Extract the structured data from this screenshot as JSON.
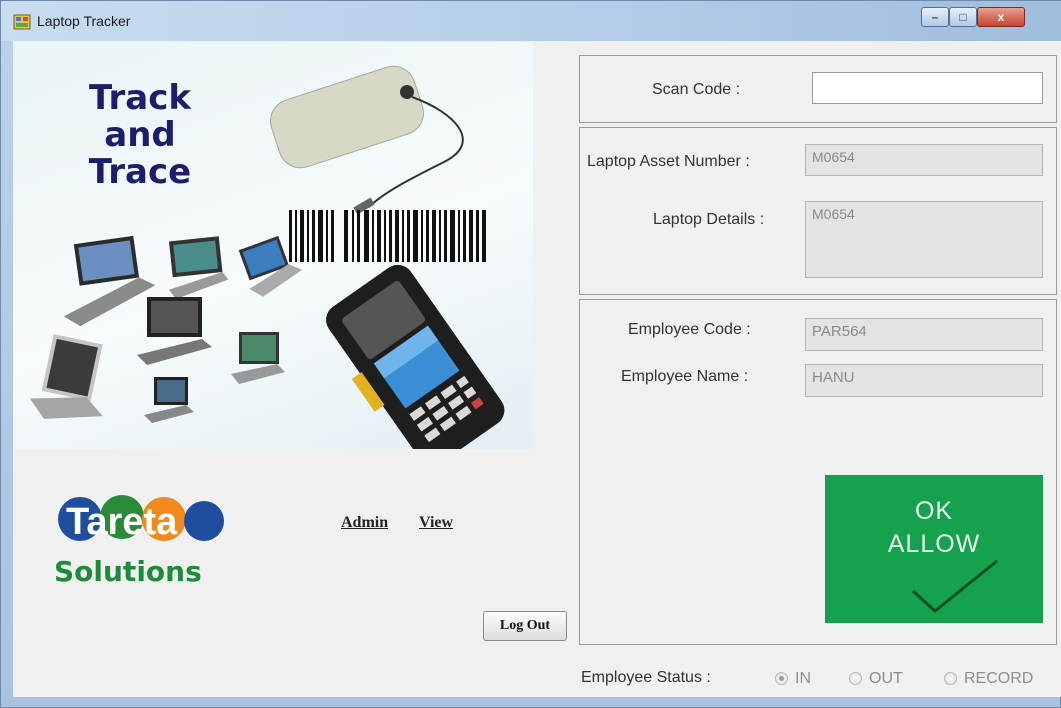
{
  "window": {
    "title": "Laptop Tracker",
    "minimize_glyph": "–",
    "maximize_glyph": "□",
    "close_glyph": "x"
  },
  "hero": {
    "title_lines": [
      "Track",
      "and",
      "Trace"
    ]
  },
  "logo": {
    "text_top": "Tareta",
    "text_bottom": "Solutions"
  },
  "links": {
    "admin": "Admin",
    "view": "View"
  },
  "buttons": {
    "logout": "Log Out"
  },
  "scan": {
    "label": "Scan Code :",
    "value": ""
  },
  "laptop": {
    "asset_label": "Laptop Asset Number :",
    "asset_value": "M0654",
    "details_label": "Laptop Details :",
    "details_value": "M0654"
  },
  "employee": {
    "code_label": "Employee Code :",
    "code_value": "PAR564",
    "name_label": "Employee Name :",
    "name_value": "HANU"
  },
  "status_panel": {
    "line1": "OK",
    "line2": "ALLOW",
    "color": "#16a14f"
  },
  "employee_status": {
    "label": "Employee Status :",
    "options": [
      {
        "label": "IN",
        "checked": true
      },
      {
        "label": "OUT",
        "checked": false
      },
      {
        "label": "RECORD",
        "checked": false
      }
    ]
  }
}
